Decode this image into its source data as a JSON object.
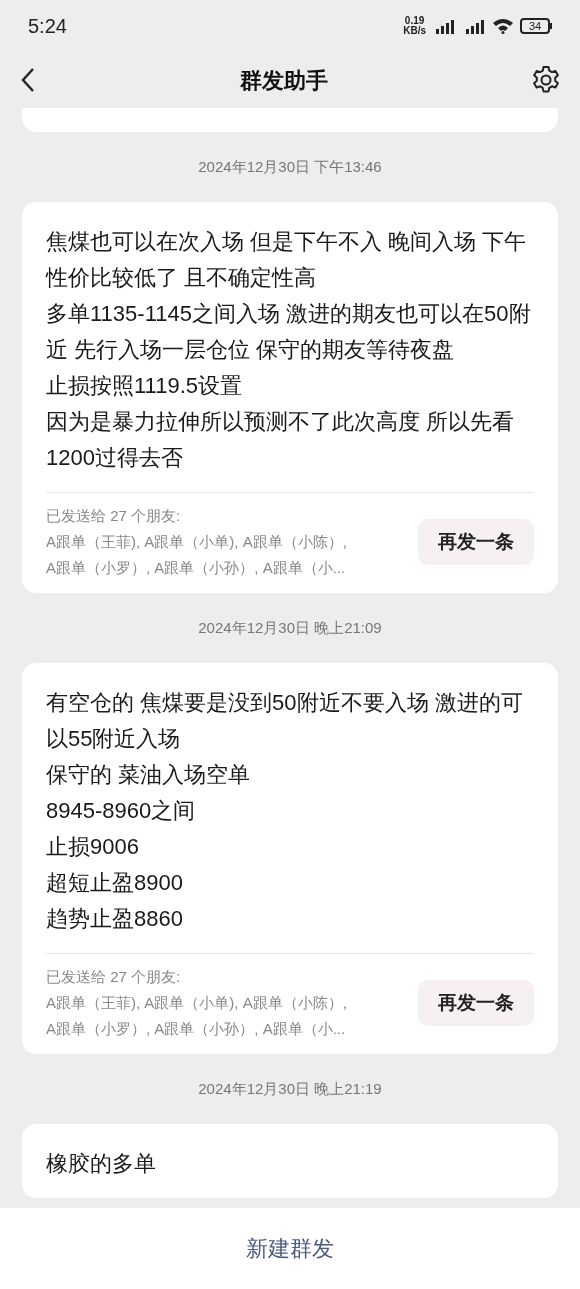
{
  "status_bar": {
    "time": "5:24",
    "net_speed_value": "0.19",
    "net_speed_unit": "KB/s",
    "battery": "34"
  },
  "header": {
    "title": "群发助手"
  },
  "messages": [
    {
      "timestamp": "2024年12月30日 下午13:46",
      "paragraphs": [
        "焦煤也可以在次入场 但是下午不入 晚间入场 下午性价比较低了 且不确定性高",
        "多单1135-1145之间入场 激进的期友也可以在50附近 先行入场一层仓位 保守的期友等待夜盘",
        "止损按照1119.5设置",
        "因为是暴力拉伸所以预测不了此次高度 所以先看1200过得去否"
      ],
      "sent_to": "已发送给 27 个朋友:",
      "recipient_lines": [
        "A跟单（王菲), A跟单（小单), A跟单（小陈）,",
        "A跟单（小罗）, A跟单（小孙）, A跟单（小..."
      ],
      "resend_button": "再发一条"
    },
    {
      "timestamp": "2024年12月30日 晚上21:09",
      "paragraphs": [
        "有空仓的 焦煤要是没到50附近不要入场 激进的可以55附近入场",
        "保守的 菜油入场空单",
        "8945-8960之间",
        "止损9006",
        "超短止盈8900",
        "趋势止盈8860"
      ],
      "sent_to": "已发送给 27 个朋友:",
      "recipient_lines": [
        "A跟单（王菲), A跟单（小单), A跟单（小陈）,",
        "A跟单（小罗）, A跟单（小孙）, A跟单（小..."
      ],
      "resend_button": "再发一条"
    },
    {
      "timestamp": "2024年12月30日 晚上21:19",
      "paragraphs": [
        "橡胶的多单"
      ]
    }
  ],
  "bottom_button": "新建群发"
}
